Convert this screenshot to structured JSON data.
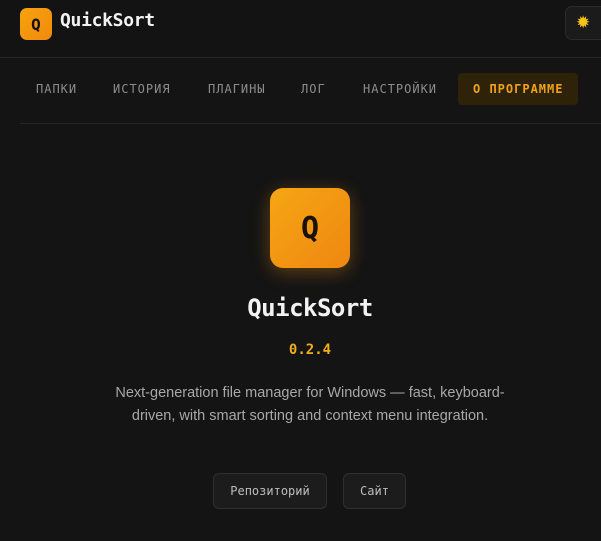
{
  "header": {
    "logo_letter": "Q",
    "app_name": "QuickSort",
    "theme_toggle_icon": "sun-icon"
  },
  "tabs": [
    {
      "label": "ПАПКИ",
      "active": false
    },
    {
      "label": "ИСТОРИЯ",
      "active": false
    },
    {
      "label": "ПЛАГИНЫ",
      "active": false
    },
    {
      "label": "ЛОГ",
      "active": false
    },
    {
      "label": "НАСТРОЙКИ",
      "active": false
    },
    {
      "label": "О ПРОГРАММЕ",
      "active": true
    }
  ],
  "about": {
    "logo_letter": "Q",
    "name": "QuickSort",
    "version": "0.2.4",
    "description": "Next-generation file manager for Windows — fast, keyboard-driven, with smart sorting and context menu integration.",
    "repo_button": "Репозиторий",
    "site_button": "Сайт"
  },
  "colors": {
    "background": "#141414",
    "accent": "#f0a21a",
    "version": "#f0ae1a",
    "active_tab_bg": "#2e2208"
  }
}
